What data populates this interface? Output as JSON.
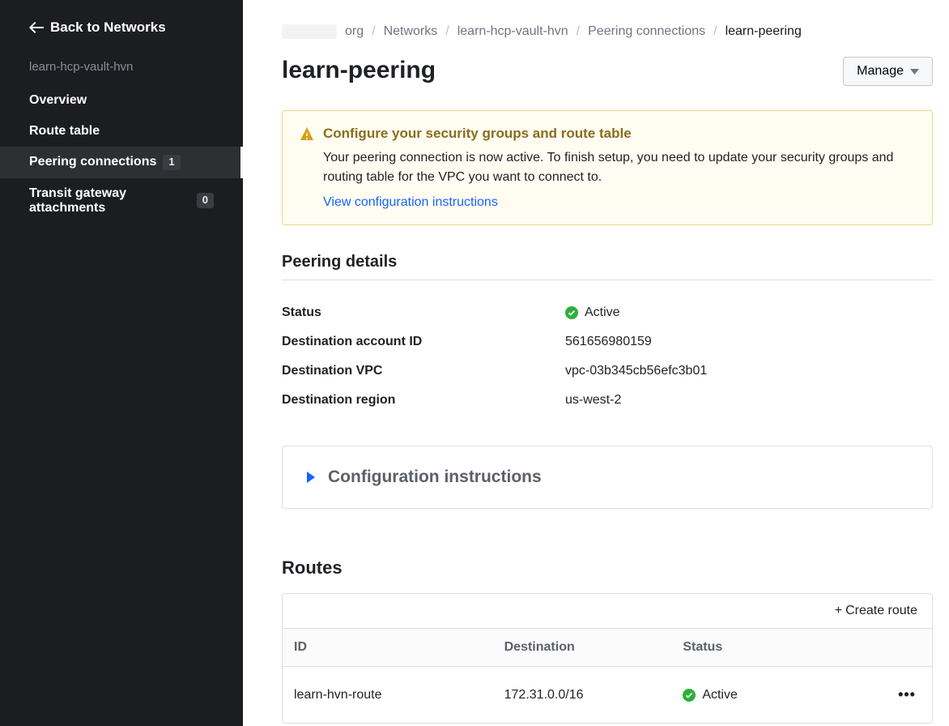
{
  "sidebar": {
    "back_label": "Back to Networks",
    "context": "learn-hcp-vault-hvn",
    "items": [
      {
        "label": "Overview",
        "active": false
      },
      {
        "label": "Route table",
        "active": false
      },
      {
        "label": "Peering connections",
        "badge": "1",
        "active": true
      },
      {
        "label": "Transit gateway attachments",
        "badge": "0",
        "active": false
      }
    ]
  },
  "breadcrumb": {
    "org_suffix": "org",
    "networks": "Networks",
    "hvn": "learn-hcp-vault-hvn",
    "section": "Peering connections",
    "current": "learn-peering"
  },
  "page": {
    "title": "learn-peering",
    "manage_label": "Manage"
  },
  "alert": {
    "title": "Configure your security groups and route table",
    "body": "Your peering connection is now active. To finish setup, you need to update your security groups and routing table for the VPC you want to connect to.",
    "link": "View configuration instructions"
  },
  "details": {
    "title": "Peering details",
    "rows": [
      {
        "label": "Status",
        "value": "Active",
        "status": true
      },
      {
        "label": "Destination account ID",
        "value": "561656980159"
      },
      {
        "label": "Destination VPC",
        "value": "vpc-03b345cb56efc3b01"
      },
      {
        "label": "Destination region",
        "value": "us-west-2"
      }
    ]
  },
  "accordion": {
    "title": "Configuration instructions"
  },
  "routes": {
    "title": "Routes",
    "create_label": "Create route",
    "columns": {
      "id": "ID",
      "dest": "Destination",
      "status": "Status"
    },
    "rows": [
      {
        "id": "learn-hvn-route",
        "dest": "172.31.0.0/16",
        "status": "Active"
      }
    ]
  }
}
